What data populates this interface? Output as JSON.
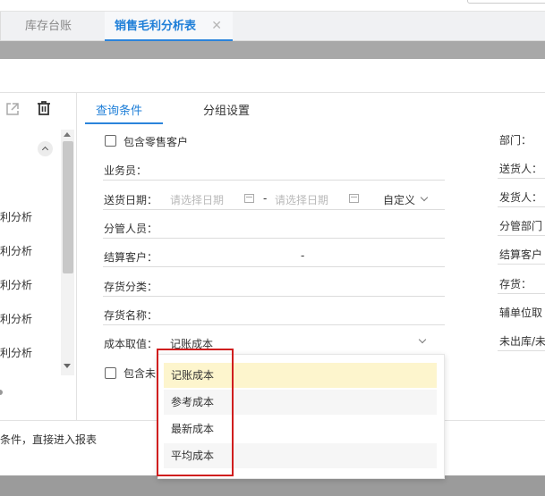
{
  "tabs": [
    {
      "label": "库存台账"
    },
    {
      "label": "销售毛利分析表"
    }
  ],
  "tab_close_glyph": "✕",
  "toolbar": {
    "export_icon": "external-link-icon",
    "delete_icon": "trash-icon"
  },
  "left_list": [
    "利分析",
    "利分析",
    "利分析",
    "利分析",
    "利分析"
  ],
  "footer_hint": "条件，直接进入报表",
  "query_tabs": {
    "conditions": "查询条件",
    "grouping": "分组设置"
  },
  "form": {
    "include_retail": "包含零售客户",
    "salesman": "业务员：",
    "delivery_date": "送货日期：",
    "date_from_placeholder": "请选择日期",
    "date_sep": "-",
    "date_to_placeholder": "请选择日期",
    "date_mode": "自定义",
    "manager": "分管人员：",
    "settle_customer": "结算客户：",
    "settle_sep": "-",
    "stock_category": "存货分类：",
    "stock_name": "存货名称：",
    "cost_basis": "成本取值：",
    "cost_basis_value": "记账成本",
    "include_partial": "包含未"
  },
  "cost_options": [
    {
      "label": "记账成本",
      "selected": true
    },
    {
      "label": "参考成本",
      "selected": false
    },
    {
      "label": "最新成本",
      "selected": false
    },
    {
      "label": "平均成本",
      "selected": false
    }
  ],
  "right_column": [
    "部门：",
    "送货人：",
    "发货人：",
    "分管部门",
    "结算客户",
    "存货：",
    "辅单位取",
    "未出库/未"
  ],
  "colors": {
    "accent": "#1f7fd8",
    "highlight": "#d01e1e",
    "selected_option": "#fdf5cd"
  }
}
